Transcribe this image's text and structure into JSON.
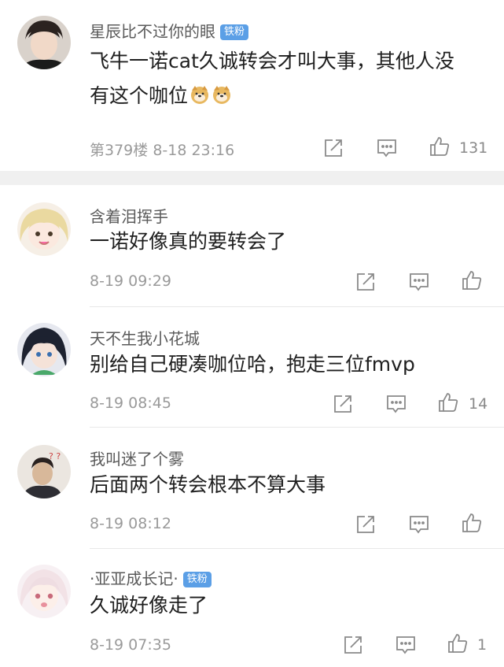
{
  "comments": [
    {
      "username": "星辰比不过你的眼",
      "badge": "铁粉",
      "text_line1": "飞牛一诺cat久诚转会才叫大事，其他人没",
      "text_line2": "有这个咖位",
      "emojis": [
        "doge-emoji",
        "doge-emoji"
      ],
      "floor": "第379楼",
      "time": "8-18 23:16",
      "likes": "131"
    },
    {
      "username": "含着泪挥手",
      "badge": "",
      "text_line1": "一诺好像真的要转会了",
      "time": "8-19 09:29",
      "likes": ""
    },
    {
      "username": "天不生我小花城",
      "badge": "",
      "text_line1": "别给自己硬凑咖位哈，抱走三位fmvp",
      "time": "8-19 08:45",
      "likes": "14"
    },
    {
      "username": "我叫迷了个雾",
      "badge": "",
      "text_line1": "后面两个转会根本不算大事",
      "time": "8-19 08:12",
      "likes": ""
    },
    {
      "username": "·亚亚成长记·",
      "badge": "铁粉",
      "text_line1": "久诚好像走了",
      "time": "8-19 07:35",
      "likes": "1"
    }
  ],
  "icons": {
    "share": "share-icon",
    "reply": "comment-icon",
    "like": "thumbs-up-icon"
  },
  "colors": {
    "badge": "#5b9fe6",
    "meta": "#9a9a9a",
    "icon": "#8a8a8a"
  }
}
